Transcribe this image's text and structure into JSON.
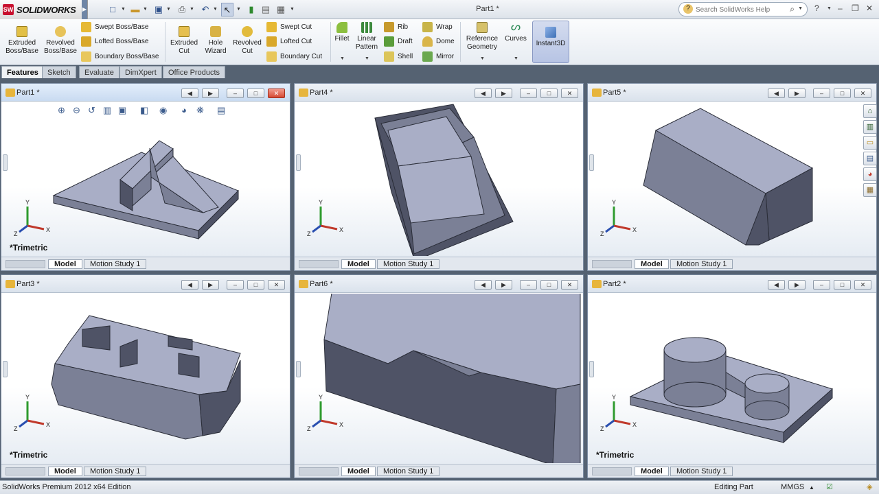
{
  "app": {
    "brand": "SOLIDWORKS",
    "brand_mark": "SW",
    "window_title": "Part1 *"
  },
  "quick_access": [
    {
      "name": "new-icon",
      "glyph": "□"
    },
    {
      "name": "open-icon",
      "glyph": "▭"
    },
    {
      "name": "save-icon",
      "glyph": "▣"
    },
    {
      "name": "print-icon",
      "glyph": "⎙"
    },
    {
      "name": "undo-icon",
      "glyph": "↶"
    },
    {
      "name": "select-icon",
      "glyph": "↖"
    },
    {
      "name": "rebuild-icon",
      "glyph": "⦿"
    },
    {
      "name": "file-properties-icon",
      "glyph": "▤"
    },
    {
      "name": "options-icon",
      "glyph": "▦"
    }
  ],
  "search": {
    "placeholder": "Search SolidWorks Help"
  },
  "ribbon": {
    "extruded_boss": "Extruded Boss/Base",
    "revolved_boss": "Revolved Boss/Base",
    "swept_boss": "Swept Boss/Base",
    "lofted_boss": "Lofted Boss/Base",
    "boundary_boss": "Boundary Boss/Base",
    "extruded_cut": "Extruded Cut",
    "hole_wizard": "Hole Wizard",
    "revolved_cut": "Revolved Cut",
    "swept_cut": "Swept Cut",
    "lofted_cut": "Lofted Cut",
    "boundary_cut": "Boundary Cut",
    "fillet": "Fillet",
    "linear_pattern": "Linear Pattern",
    "rib": "Rib",
    "draft": "Draft",
    "shell": "Shell",
    "wrap": "Wrap",
    "dome": "Dome",
    "mirror": "Mirror",
    "reference_geometry": "Reference Geometry",
    "curves": "Curves",
    "instant3d": "Instant3D"
  },
  "tabs": [
    "Features",
    "Sketch",
    "Evaluate",
    "DimXpert",
    "Office Products"
  ],
  "viewports": [
    {
      "title": "Part1 *",
      "view_label": "*Trimetric",
      "active": true
    },
    {
      "title": "Part4 *",
      "view_label": "",
      "active": false
    },
    {
      "title": "Part5 *",
      "view_label": "",
      "active": false
    },
    {
      "title": "Part3 *",
      "view_label": "*Trimetric",
      "active": false
    },
    {
      "title": "Part6 *",
      "view_label": "",
      "active": false
    },
    {
      "title": "Part2 *",
      "view_label": "*Trimetric",
      "active": false
    }
  ],
  "bottom_tabs": {
    "model": "Model",
    "motion": "Motion Study 1"
  },
  "axis_labels": {
    "x": "X",
    "y": "Y",
    "z": "Z"
  },
  "status": {
    "edition": "SolidWorks Premium 2012 x64 Edition",
    "mode": "Editing Part",
    "units": "MMGS"
  },
  "colors": {
    "part_face_light": "#a9aec6",
    "part_face_mid": "#7b8096",
    "part_face_dark": "#4f5366",
    "app_background": "#556272"
  }
}
